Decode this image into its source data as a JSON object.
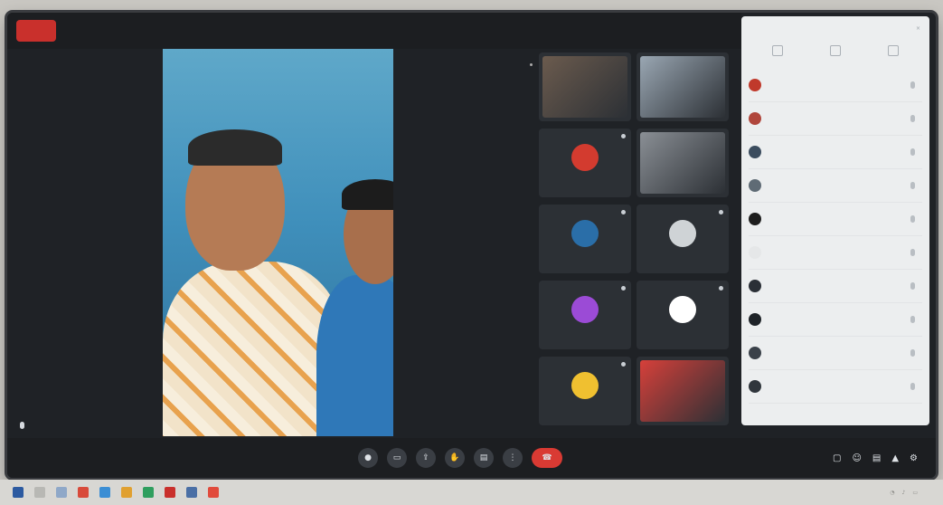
{
  "app": {
    "logo_text": "",
    "meeting_title": ""
  },
  "main_video": {
    "speaker_label": ""
  },
  "grid_tiles": [
    {
      "label": "",
      "avatar_color": "#6b5b4e",
      "kind": "photo"
    },
    {
      "label": "",
      "avatar_color": "#9aa7b3",
      "kind": "photo"
    },
    {
      "label": "",
      "avatar_color": "#d33b2f",
      "kind": "avatar"
    },
    {
      "label": "",
      "avatar_color": "#8a8f95",
      "kind": "photo"
    },
    {
      "label": "",
      "avatar_color": "#2a6ea8",
      "kind": "avatar"
    },
    {
      "label": "",
      "avatar_color": "#cfd3d6",
      "kind": "avatar"
    },
    {
      "label": "",
      "avatar_color": "#9b4bd6",
      "kind": "avatar"
    },
    {
      "label": "",
      "avatar_color": "#ffffff",
      "kind": "avatar"
    },
    {
      "label": "",
      "avatar_color": "#f0c030",
      "kind": "avatar"
    },
    {
      "label": "",
      "avatar_color": "#d6403a",
      "kind": "photo"
    }
  ],
  "panel": {
    "title": "",
    "actions": [
      "",
      "",
      ""
    ],
    "participants": [
      {
        "name": "",
        "color": "#c0392b"
      },
      {
        "name": "",
        "color": "#b0463c"
      },
      {
        "name": "",
        "color": "#3b4c5e"
      },
      {
        "name": "",
        "color": "#5f6b75"
      },
      {
        "name": "",
        "color": "#1e1e1e"
      },
      {
        "name": "",
        "color": "#e5e7e8"
      },
      {
        "name": "",
        "color": "#2a2f36"
      },
      {
        "name": "",
        "color": "#1e2328"
      },
      {
        "name": "",
        "color": "#3a4149"
      },
      {
        "name": "",
        "color": "#30363c"
      }
    ]
  },
  "controls": {
    "time": "",
    "status": "",
    "buttons": [
      "",
      "",
      "",
      "",
      "",
      ""
    ]
  },
  "colors": {
    "end_call": "#d93a33",
    "accent": "#c9302c"
  },
  "icons": [
    "mic-icon",
    "video-icon",
    "share-icon",
    "hand-icon",
    "chat-icon",
    "more-icon",
    "end-call-icon",
    "participants-icon",
    "settings-icon"
  ]
}
